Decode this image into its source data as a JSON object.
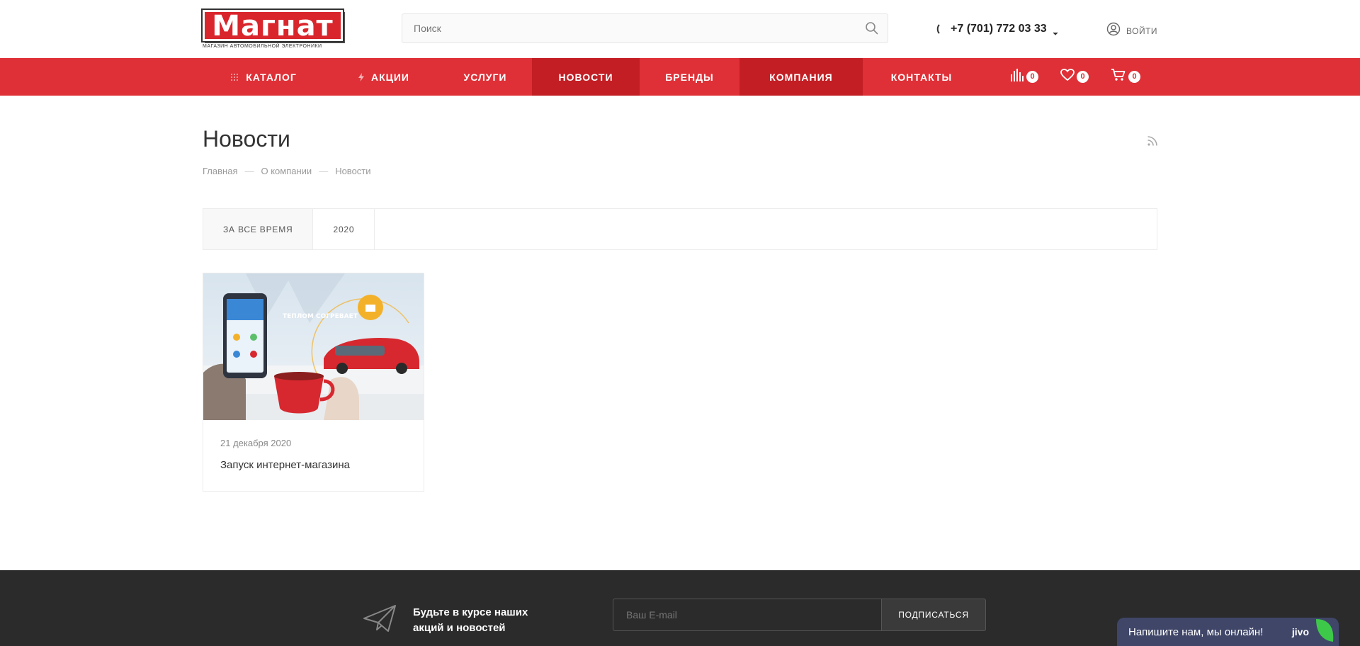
{
  "header": {
    "logo_text": "Магнат",
    "logo_subtitle": "МАГАЗИН АВТОМОБИЛЬНОЙ ЭЛЕКТРОНИКИ",
    "search_placeholder": "Поиск",
    "phone": "+7 (701) 772 03 33",
    "login_label": "ВОЙТИ"
  },
  "nav": {
    "items": [
      {
        "label": "КАТАЛОГ"
      },
      {
        "label": "АКЦИИ"
      },
      {
        "label": "УСЛУГИ"
      },
      {
        "label": "НОВОСТИ"
      },
      {
        "label": "БРЕНДЫ"
      },
      {
        "label": "КОМПАНИЯ"
      },
      {
        "label": "КОНТАКТЫ"
      }
    ],
    "compare_count": "0",
    "favorites_count": "0",
    "cart_count": "0"
  },
  "main": {
    "title": "Новости",
    "breadcrumb": [
      "Главная",
      "О компании",
      "Новости"
    ],
    "filter_tabs": [
      "ЗА ВСЕ ВРЕМЯ",
      "2020"
    ],
    "news": [
      {
        "date": "21 декабря 2020",
        "title": "Запуск интернет-магазина",
        "image_caption": "ТЕПЛОМ СОГРЕВАЕТ"
      }
    ]
  },
  "footer": {
    "subscribe_text": "Будьте в курсе наших акций и новостей",
    "email_placeholder": "Ваш E-mail",
    "subscribe_button": "ПОДПИСАТЬСЯ"
  },
  "chat": {
    "text": "Напишите нам, мы онлайн!",
    "brand": "jivo"
  },
  "colors": {
    "brand_red": "#df3037",
    "nav_active": "#c21e24",
    "footer_bg": "#2b2b2b",
    "chat_bg": "#3f4668"
  }
}
